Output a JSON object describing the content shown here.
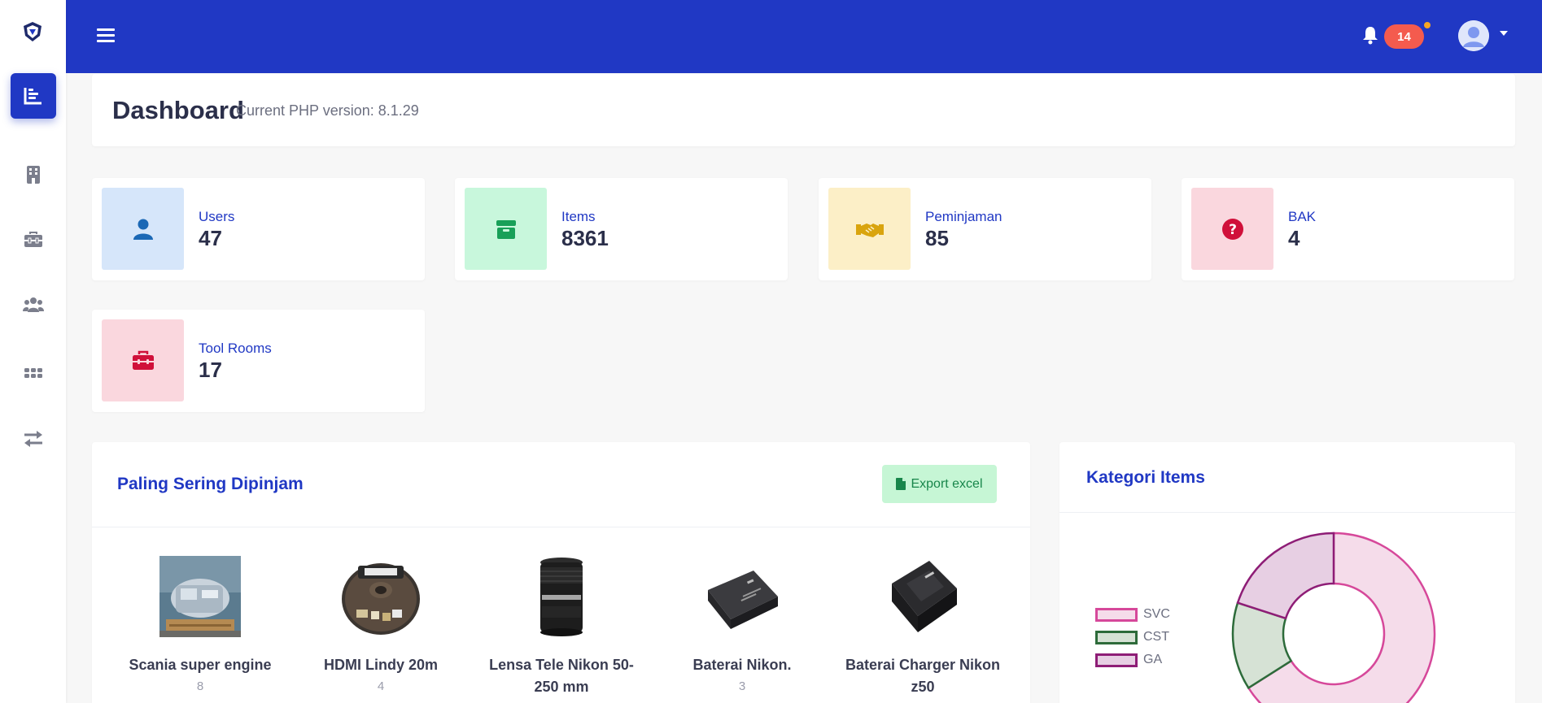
{
  "header": {
    "notification_count": "14"
  },
  "page": {
    "title": "Dashboard",
    "php_version": "Current PHP version: 8.1.29"
  },
  "sidebar": {
    "items": [
      {
        "icon": "chart-bar-icon",
        "active": true
      },
      {
        "icon": "building-icon",
        "active": false
      },
      {
        "icon": "toolbox-icon",
        "active": false
      },
      {
        "icon": "users-icon",
        "active": false
      },
      {
        "icon": "grid-icon",
        "active": false
      },
      {
        "icon": "exchange-icon",
        "active": false
      }
    ]
  },
  "stats": [
    {
      "label": "Users",
      "value": "47",
      "icon": "user-icon",
      "bg": "#d6e6fa",
      "fg": "#1b68b5"
    },
    {
      "label": "Items",
      "value": "8361",
      "icon": "box-icon",
      "bg": "#c8f7dc",
      "fg": "#18a058"
    },
    {
      "label": "Peminjaman",
      "value": "85",
      "icon": "handshake-icon",
      "bg": "#fcefc7",
      "fg": "#d9a40e"
    },
    {
      "label": "BAK",
      "value": "4",
      "icon": "question-circle-icon",
      "bg": "#fad7de",
      "fg": "#d0103a"
    },
    {
      "label": "Tool Rooms",
      "value": "17",
      "icon": "toolbox-icon",
      "bg": "#fad7de",
      "fg": "#d0103a"
    }
  ],
  "popular": {
    "title": "Paling Sering Dipinjam",
    "export_label": "Export excel",
    "items": [
      {
        "name": "Scania super engine",
        "count": "8"
      },
      {
        "name": "HDMI Lindy 20m",
        "count": "4"
      },
      {
        "name": "Lensa Tele Nikon 50-250 mm",
        "count": ""
      },
      {
        "name": "Baterai Nikon.",
        "count": "3"
      },
      {
        "name": "Baterai Charger Nikon z50",
        "count": ""
      }
    ]
  },
  "kategori": {
    "title": "Kategori Items"
  },
  "chart_data": {
    "type": "pie",
    "title": "",
    "categories": [
      "SVC",
      "CST",
      "GA"
    ],
    "values": [
      66,
      14,
      20
    ],
    "colors": {
      "SVC": {
        "fill": "#f5dcea",
        "stroke": "#d6489a"
      },
      "CST": {
        "fill": "#d6e2d5",
        "stroke": "#2d6b3a"
      },
      "GA": {
        "fill": "#e7cfe3",
        "stroke": "#8e1d76"
      }
    },
    "legend_position": "left",
    "donut": true
  },
  "colors": {
    "primary": "#2038c4",
    "badge": "#f45b4e",
    "background": "#f7f7f7"
  }
}
